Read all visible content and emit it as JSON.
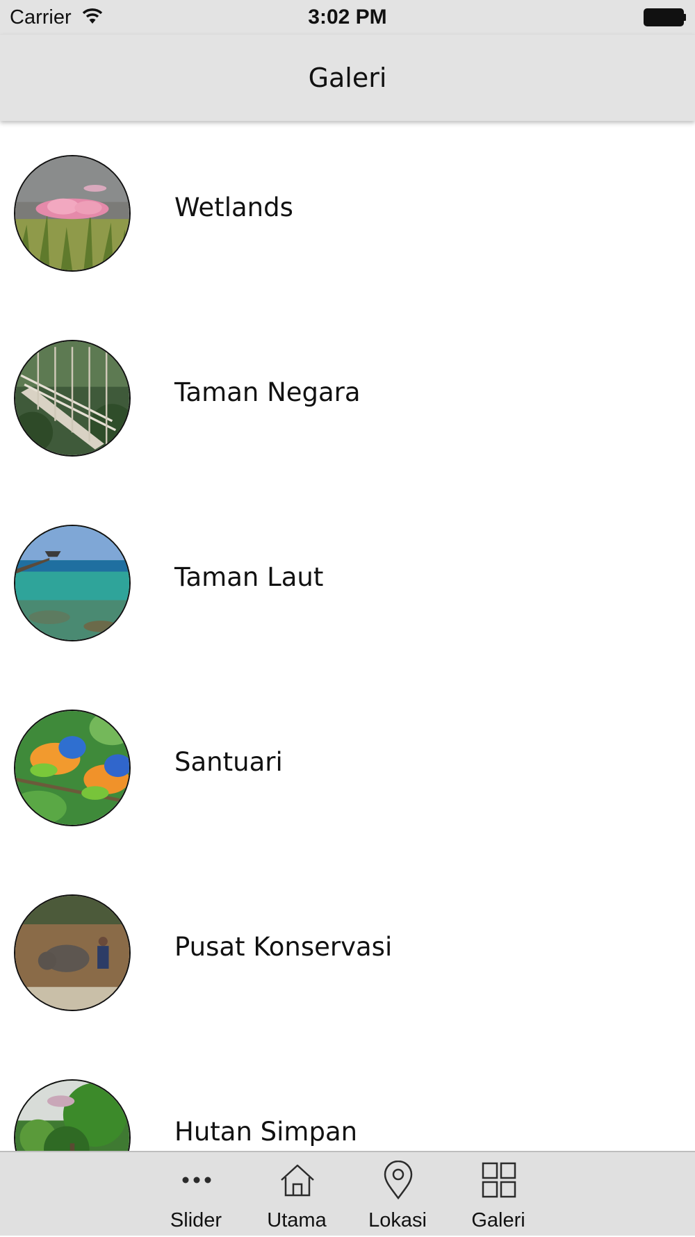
{
  "status_bar": {
    "carrier": "Carrier",
    "time": "3:02 PM"
  },
  "nav": {
    "title": "Galeri"
  },
  "gallery": {
    "items": [
      {
        "label": "Wetlands",
        "icon": "lotus-photo"
      },
      {
        "label": "Taman Negara",
        "icon": "canopy-walk-photo"
      },
      {
        "label": "Taman Laut",
        "icon": "sea-jetty-photo"
      },
      {
        "label": "Santuari",
        "icon": "parrots-photo"
      },
      {
        "label": "Pusat Konservasi",
        "icon": "elephant-river-photo"
      },
      {
        "label": "Hutan Simpan",
        "icon": "forest-photo"
      }
    ]
  },
  "tab_bar": {
    "tabs": [
      {
        "label": "Slider",
        "icon": "more-dots-icon"
      },
      {
        "label": "Utama",
        "icon": "home-icon"
      },
      {
        "label": "Lokasi",
        "icon": "location-pin-icon"
      },
      {
        "label": "Galeri",
        "icon": "grid-icon"
      }
    ]
  }
}
